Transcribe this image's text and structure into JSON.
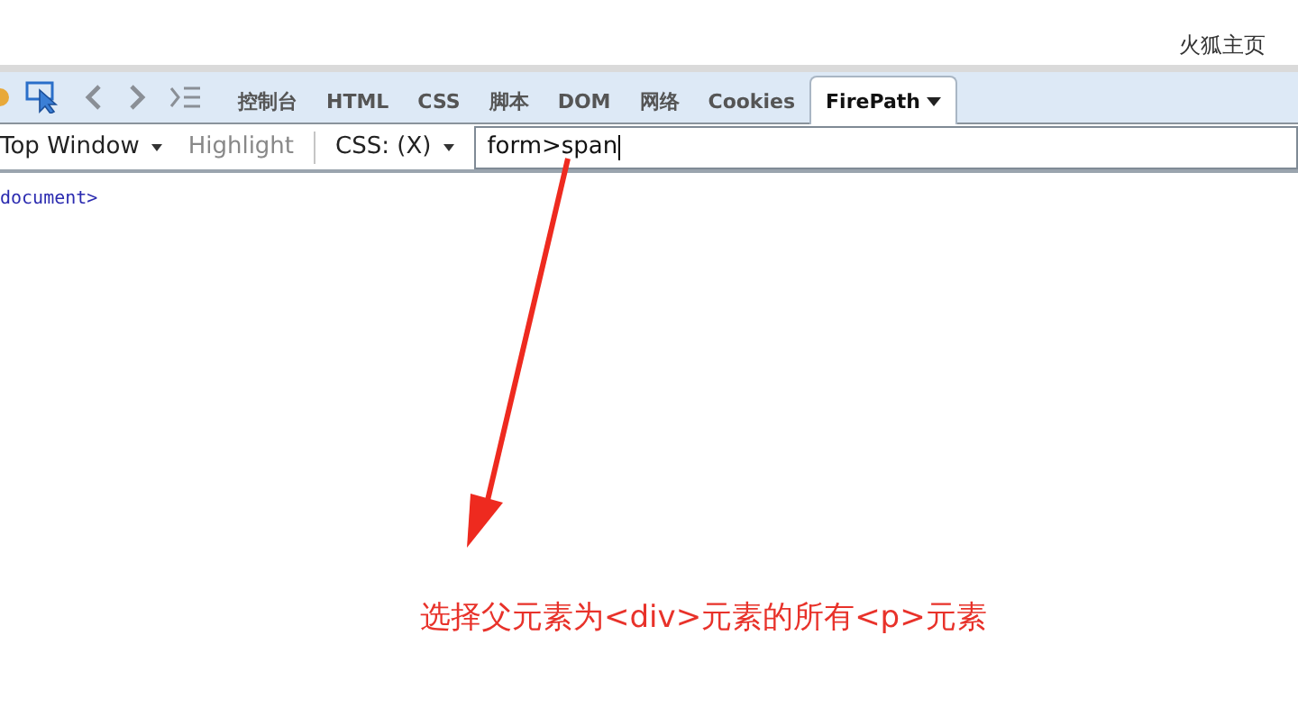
{
  "browser": {
    "home_link": "火狐主页"
  },
  "tabs": [
    {
      "label": "控制台",
      "selected": false
    },
    {
      "label": "HTML",
      "selected": false
    },
    {
      "label": "CSS",
      "selected": false
    },
    {
      "label": "脚本",
      "selected": false
    },
    {
      "label": "DOM",
      "selected": false
    },
    {
      "label": "网络",
      "selected": false
    },
    {
      "label": "Cookies",
      "selected": false
    },
    {
      "label": "FirePath",
      "selected": true
    }
  ],
  "toolbar": {
    "frame": "Top Window",
    "highlight": "Highlight",
    "mode": "CSS: (X)",
    "query": {
      "value": "form>span"
    }
  },
  "tree": {
    "node": "document>"
  },
  "annotation": {
    "text": "选择父元素为<div>元素的所有<p>元素"
  }
}
